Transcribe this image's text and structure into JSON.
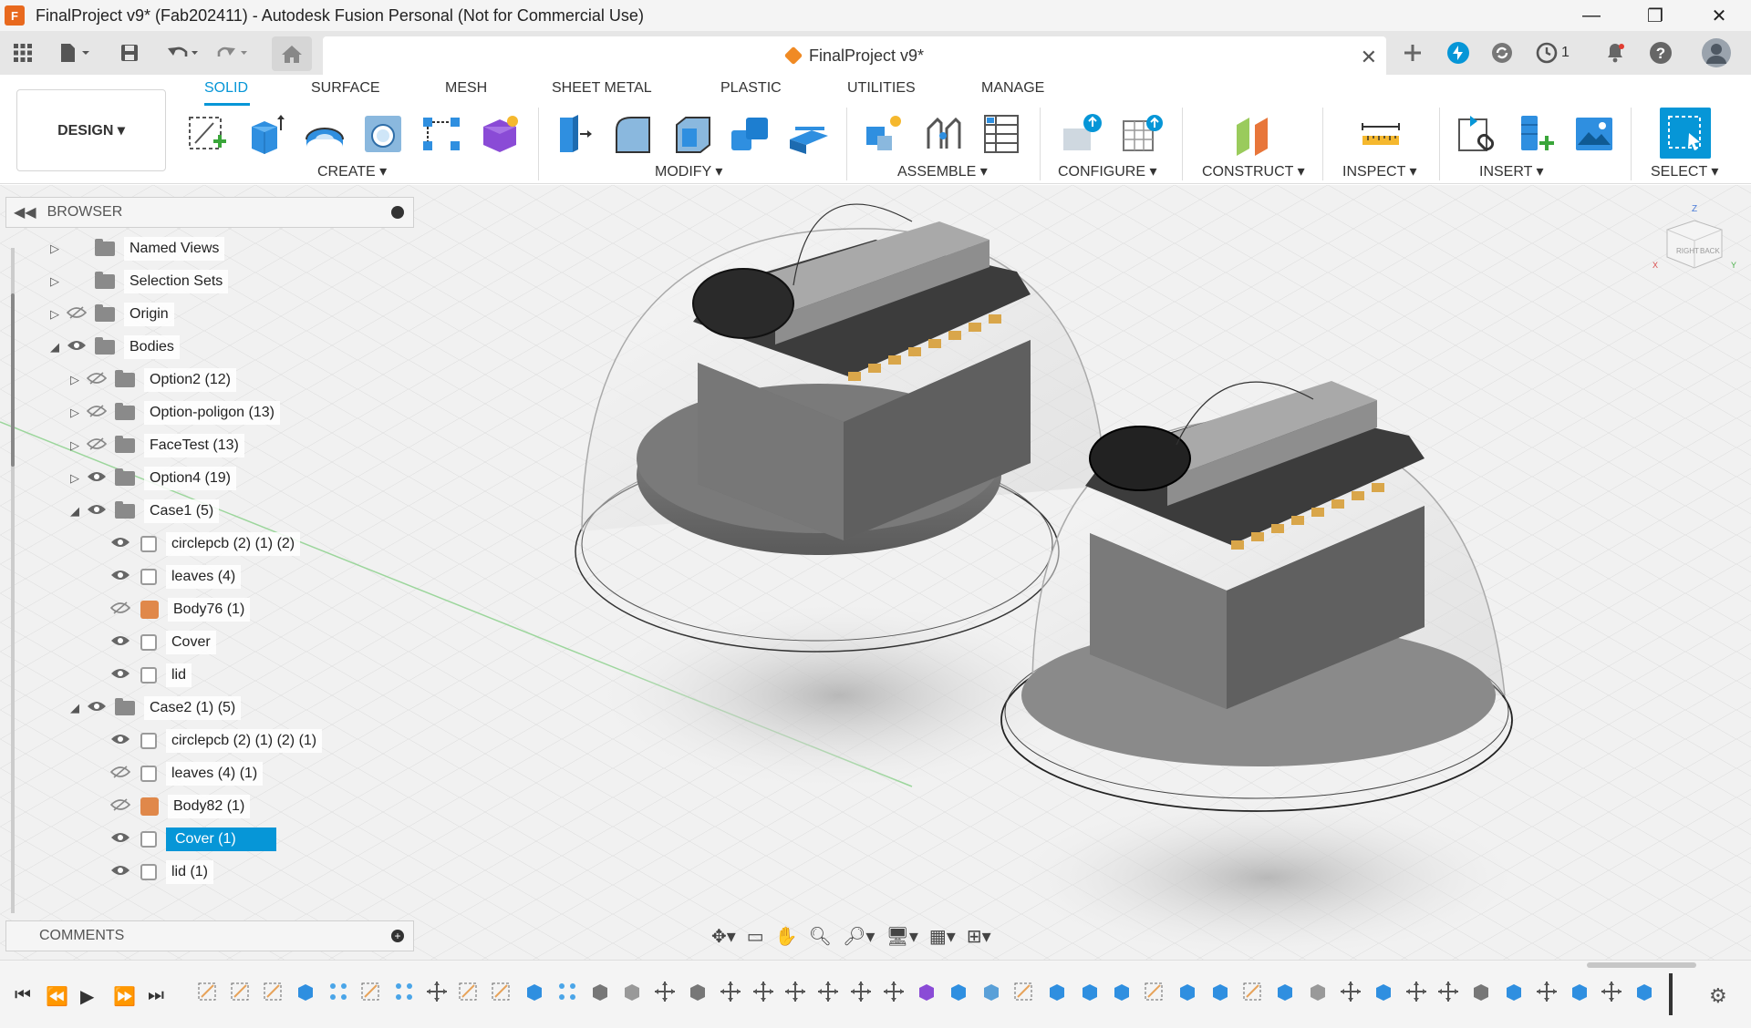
{
  "window": {
    "app_badge": "F",
    "title": "FinalProject v9* (Fab202411) - Autodesk Fusion Personal (Not for Commercial Use)",
    "controls": [
      "—",
      "❐",
      "✕"
    ]
  },
  "document_tab": {
    "title": "FinalProject v9*",
    "close": "✕"
  },
  "quickbar": {
    "job_count": "1"
  },
  "workspace": {
    "label": "DESIGN ▾"
  },
  "ribbon_tabs": [
    {
      "label": "SOLID",
      "active": true
    },
    {
      "label": "SURFACE"
    },
    {
      "label": "MESH"
    },
    {
      "label": "SHEET METAL"
    },
    {
      "label": "PLASTIC"
    },
    {
      "label": "UTILITIES"
    },
    {
      "label": "MANAGE"
    }
  ],
  "ribbon_groups": [
    {
      "label": "CREATE ▾"
    },
    {
      "label": "MODIFY ▾"
    },
    {
      "label": "ASSEMBLE ▾"
    },
    {
      "label": "CONFIGURE ▾"
    },
    {
      "label": "CONSTRUCT ▾"
    },
    {
      "label": "INSPECT ▾"
    },
    {
      "label": "INSERT ▾"
    },
    {
      "label": "SELECT ▾"
    }
  ],
  "browser": {
    "title": "BROWSER",
    "nodes": [
      {
        "label": "Named Views",
        "kind": "folder",
        "expand": "closed",
        "visible": null
      },
      {
        "label": "Selection Sets",
        "kind": "folder",
        "expand": "closed",
        "visible": null
      },
      {
        "label": "Origin",
        "kind": "folder",
        "expand": "closed",
        "visible": false
      },
      {
        "label": "Bodies",
        "kind": "folder",
        "expand": "open",
        "visible": true
      },
      {
        "label": "Option2 (12)",
        "kind": "folder",
        "expand": "closed",
        "visible": false
      },
      {
        "label": "Option-poligon (13)",
        "kind": "folder",
        "expand": "closed",
        "visible": false
      },
      {
        "label": "FaceTest (13)",
        "kind": "folder",
        "expand": "closed",
        "visible": false
      },
      {
        "label": "Option4 (19)",
        "kind": "folder",
        "expand": "closed",
        "visible": true
      },
      {
        "label": "Case1 (5)",
        "kind": "folder",
        "expand": "open",
        "visible": true
      },
      {
        "label": "circlepcb (2) (1) (2)",
        "kind": "body",
        "visible": true
      },
      {
        "label": "leaves (4)",
        "kind": "body",
        "visible": true
      },
      {
        "label": "Body76 (1)",
        "kind": "component",
        "visible": false
      },
      {
        "label": "Cover",
        "kind": "body",
        "visible": true
      },
      {
        "label": "lid",
        "kind": "body",
        "visible": true
      },
      {
        "label": "Case2 (1) (5)",
        "kind": "folder",
        "expand": "open",
        "visible": true
      },
      {
        "label": "circlepcb (2) (1) (2) (1)",
        "kind": "body",
        "visible": true
      },
      {
        "label": "leaves (4) (1)",
        "kind": "body",
        "visible": false
      },
      {
        "label": "Body82 (1)",
        "kind": "component",
        "visible": false
      },
      {
        "label": "Cover (1)",
        "kind": "body",
        "visible": true,
        "selected": true
      },
      {
        "label": "lid (1)",
        "kind": "body",
        "visible": true
      }
    ]
  },
  "comments": {
    "title": "COMMENTS"
  },
  "viewcube": {
    "top_face": "RIGHT",
    "side_face": "BACK",
    "axis_z": "Z",
    "axis_x": "X",
    "axis_y": "Y"
  },
  "colors": {
    "accent": "#0696d7",
    "selection": "#0696d7",
    "brand": "#e8691e"
  }
}
